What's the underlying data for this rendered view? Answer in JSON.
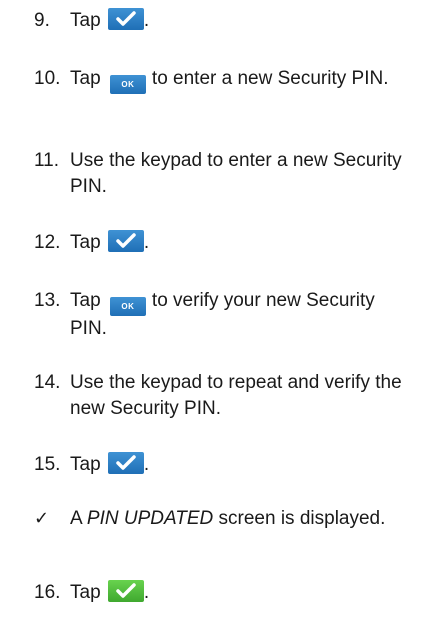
{
  "steps": [
    {
      "number": "9.",
      "before": "Tap",
      "button": "check",
      "after": "."
    },
    {
      "number": "10.",
      "before": "Tap",
      "button": "ok",
      "after": "to enter a new Security PIN."
    },
    {
      "number": "11.",
      "text": "Use the keypad to enter a new Security PIN."
    },
    {
      "number": "12.",
      "before": "Tap",
      "button": "check",
      "after": "."
    },
    {
      "number": "13.",
      "before": "Tap",
      "button": "ok",
      "after": "to verify your new Security PIN."
    },
    {
      "number": "14.",
      "text": "Use the keypad to repeat and verify the new Security PIN."
    },
    {
      "number": "15.",
      "before": "Tap",
      "button": "check",
      "after": "."
    },
    {
      "number": "16.",
      "before": "Tap",
      "button": "check-green",
      "after": "."
    }
  ],
  "result": {
    "mark": "✓",
    "lead": "A",
    "emphasis": "PIN UPDATED",
    "rest": "screen is displayed."
  },
  "ok_label": "OK",
  "colors": {
    "button_blue": "#2a7fc5",
    "button_green": "#55c23e",
    "text": "#1a1a1a"
  }
}
